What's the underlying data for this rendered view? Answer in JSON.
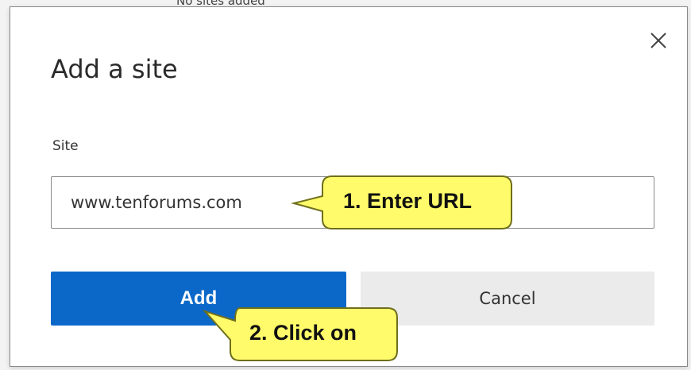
{
  "background": {
    "partial_text": "No sites added"
  },
  "dialog": {
    "title": "Add a site",
    "close_label": "×",
    "site_label": "Site",
    "site_value": "www.tenforums.com",
    "add_label": "Add",
    "cancel_label": "Cancel"
  },
  "callouts": {
    "enter_url": "1. Enter URL",
    "click_on": "2. Click on"
  },
  "colors": {
    "primary": "#0b68c9",
    "callout_fill": "#fffb6a",
    "callout_border": "#7a7a20"
  }
}
